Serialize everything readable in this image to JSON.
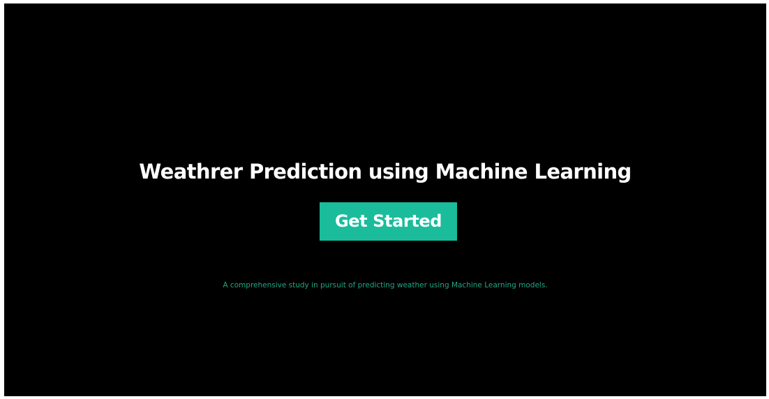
{
  "hero": {
    "title": "Weathrer Prediction using Machine Learning",
    "cta_label": "Get Started",
    "tagline": "A comprehensive study in pursuit of predicting weather using Machine Learning models."
  },
  "colors": {
    "background": "#000000",
    "title_text": "#ffffff",
    "button_bg": "#1abc9c",
    "button_text": "#ffffff",
    "tagline_text": "#1fa882"
  }
}
